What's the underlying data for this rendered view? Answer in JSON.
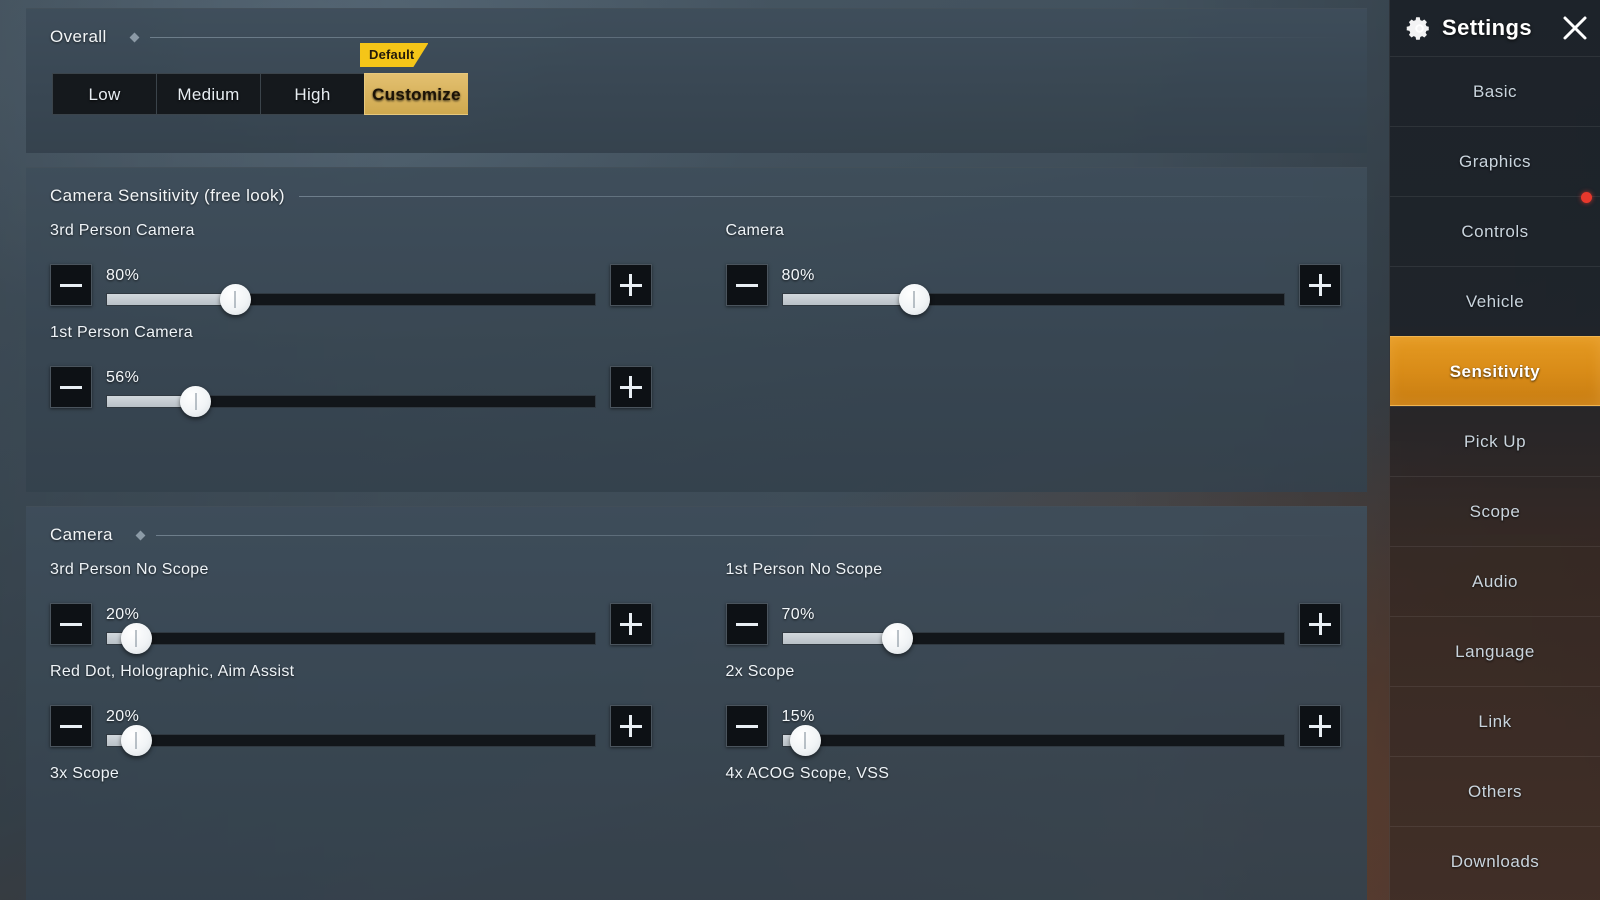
{
  "overall": {
    "title": "Overall",
    "default_tag": "Default",
    "presets": [
      {
        "label": "Low",
        "active": false
      },
      {
        "label": "Medium",
        "active": false
      },
      {
        "label": "High",
        "active": false
      },
      {
        "label": "Customize",
        "active": true
      }
    ]
  },
  "camera_sensitivity": {
    "title": "Camera Sensitivity (free look)",
    "left": [
      {
        "label": "3rd Person Camera",
        "value": "80%",
        "fill_pct": 26.3
      },
      {
        "label": "1st Person Camera",
        "value": "56%",
        "fill_pct": 18.2
      }
    ],
    "right": [
      {
        "label": "Camera",
        "value": "80%",
        "fill_pct": 26.3
      }
    ]
  },
  "camera": {
    "title": "Camera",
    "left": [
      {
        "label": "3rd Person No Scope",
        "value": "20%",
        "fill_pct": 6.0
      },
      {
        "label": "Red Dot, Holographic, Aim Assist",
        "value": "20%",
        "fill_pct": 6.0
      },
      {
        "label": "3x Scope",
        "value": "",
        "fill_pct": 0
      }
    ],
    "right": [
      {
        "label": "1st Person No Scope",
        "value": "70%",
        "fill_pct": 23.0
      },
      {
        "label": "2x Scope",
        "value": "15%",
        "fill_pct": 4.5
      },
      {
        "label": "4x ACOG Scope, VSS",
        "value": "",
        "fill_pct": 0
      }
    ]
  },
  "sidebar": {
    "title": "Settings",
    "gear_icon": "gear-icon",
    "close_icon": "close-icon",
    "items": [
      {
        "label": "Basic",
        "active": false,
        "badge": false
      },
      {
        "label": "Graphics",
        "active": false,
        "badge": false
      },
      {
        "label": "Controls",
        "active": false,
        "badge": true
      },
      {
        "label": "Vehicle",
        "active": false,
        "badge": false
      },
      {
        "label": "Sensitivity",
        "active": true,
        "badge": false
      },
      {
        "label": "Pick Up",
        "active": false,
        "badge": false
      },
      {
        "label": "Scope",
        "active": false,
        "badge": false
      },
      {
        "label": "Audio",
        "active": false,
        "badge": false
      },
      {
        "label": "Language",
        "active": false,
        "badge": false
      },
      {
        "label": "Link",
        "active": false,
        "badge": false
      },
      {
        "label": "Others",
        "active": false,
        "badge": false
      },
      {
        "label": "Downloads",
        "active": false,
        "badge": false
      }
    ]
  },
  "colors": {
    "accent_orange": "#d98c18",
    "accent_gold": "#d9b45f",
    "default_yellow": "#f5c518",
    "badge_red": "#e8382c",
    "panel_bg": "#3e4d5a"
  }
}
